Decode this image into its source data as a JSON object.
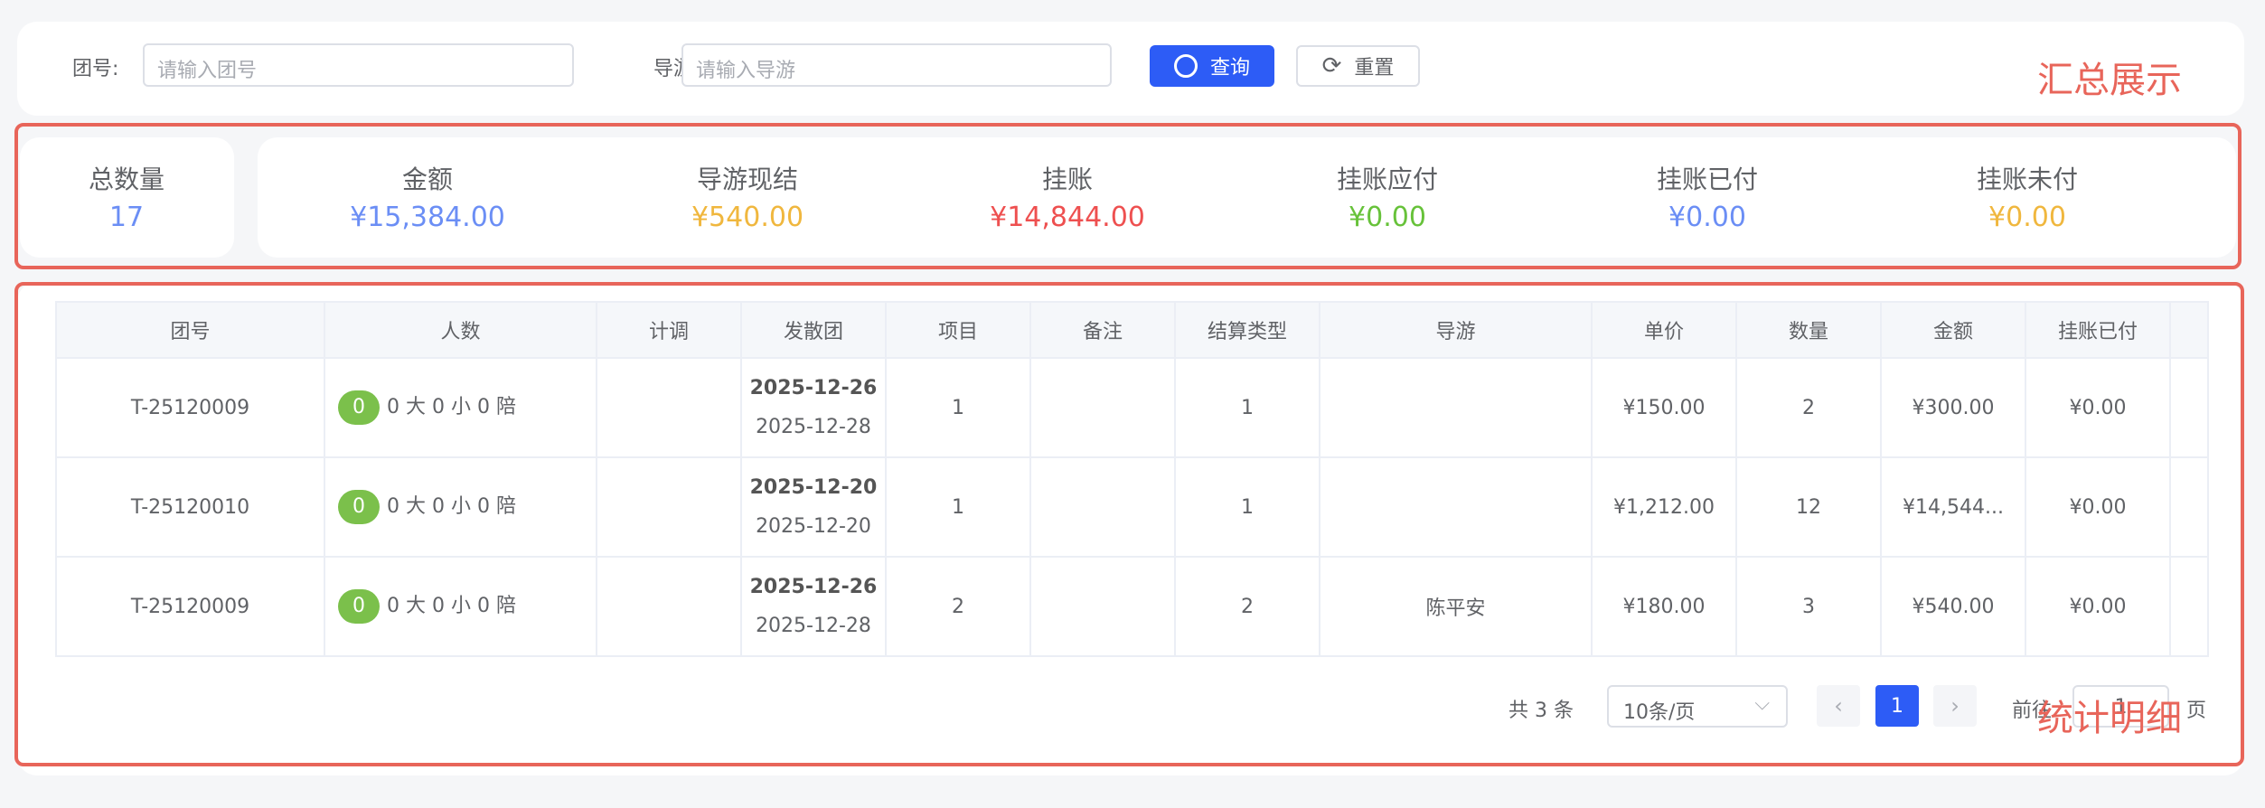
{
  "search": {
    "group_label": "团号:",
    "group_placeholder": "请输入团号",
    "guide_label": "导游:",
    "guide_placeholder": "请输入导游",
    "query_label": "查询",
    "reset_label": "重置"
  },
  "annotations": {
    "summary": "汇总展示",
    "detail": "统计明细"
  },
  "summary": {
    "total": {
      "label": "总数量",
      "value": "17"
    },
    "stats": [
      {
        "label": "金额",
        "value": "¥15,384.00",
        "color": "#6b8ef5"
      },
      {
        "label": "导游现结",
        "value": "¥540.00",
        "color": "#f0b73e"
      },
      {
        "label": "挂账",
        "value": "¥14,844.00",
        "color": "#ee5050"
      },
      {
        "label": "挂账应付",
        "value": "¥0.00",
        "color": "#67c23a"
      },
      {
        "label": "挂账已付",
        "value": "¥0.00",
        "color": "#6b8ef5"
      },
      {
        "label": "挂账未付",
        "value": "¥0.00",
        "color": "#f0b73e"
      }
    ]
  },
  "table": {
    "headers": [
      "团号",
      "人数",
      "计调",
      "发散团",
      "项目",
      "备注",
      "结算类型",
      "导游",
      "单价",
      "数量",
      "金额",
      "挂账已付",
      ""
    ],
    "rows": [
      {
        "group": "T-25120009",
        "count": "0",
        "people": "0 大 0 小 0 陪",
        "planner": "",
        "start": "2025-12-26",
        "end": "2025-12-28",
        "item": "1",
        "remark": "",
        "settle": "1",
        "guide": "",
        "price": "¥150.00",
        "qty": "2",
        "amount": "¥300.00",
        "paid": "¥0.00"
      },
      {
        "group": "T-25120010",
        "count": "0",
        "people": "0 大 0 小 0 陪",
        "planner": "",
        "start": "2025-12-20",
        "end": "2025-12-20",
        "item": "1",
        "remark": "",
        "settle": "1",
        "guide": "",
        "price": "¥1,212.00",
        "qty": "12",
        "amount": "¥14,544...",
        "paid": "¥0.00"
      },
      {
        "group": "T-25120009",
        "count": "0",
        "people": "0 大 0 小 0 陪",
        "planner": "",
        "start": "2025-12-26",
        "end": "2025-12-28",
        "item": "2",
        "remark": "",
        "settle": "2",
        "guide": "陈平安",
        "price": "¥180.00",
        "qty": "3",
        "amount": "¥540.00",
        "paid": "¥0.00"
      }
    ]
  },
  "pagination": {
    "total": "共 3 条",
    "page_size": "10条/页",
    "current": "1",
    "goto_label": "前往",
    "goto_value": "1",
    "page_suffix": "页"
  }
}
